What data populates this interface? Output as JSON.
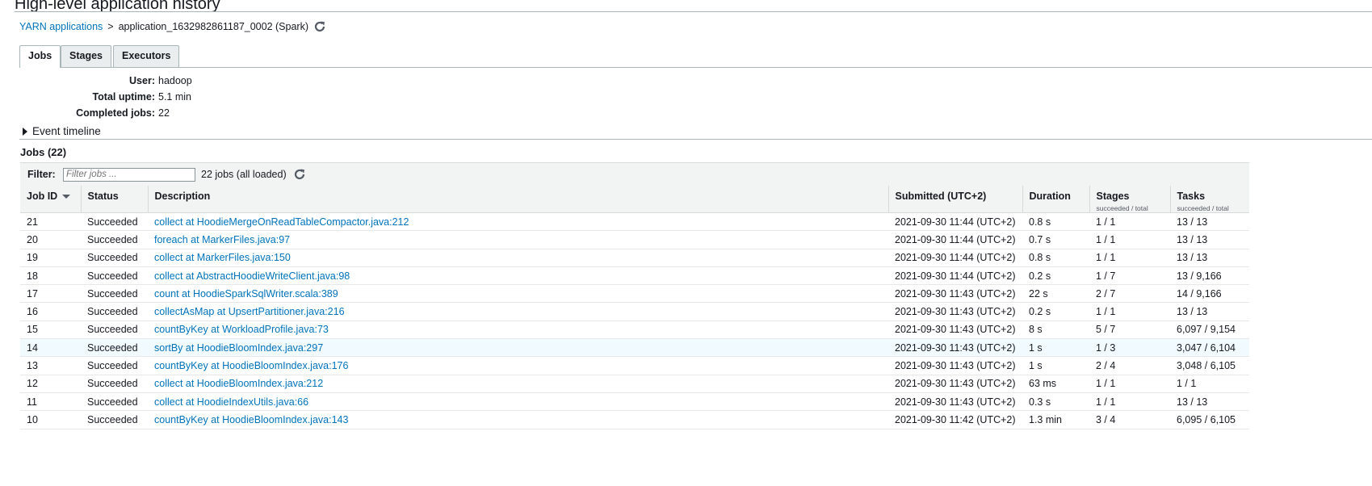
{
  "page": {
    "title": "High-level application history"
  },
  "breadcrumb": {
    "root": "YARN applications",
    "separator": ">",
    "current": "application_1632982861187_0002 (Spark)",
    "refresh_icon": "refresh-icon"
  },
  "tabs": [
    {
      "label": "Jobs",
      "active": true
    },
    {
      "label": "Stages",
      "active": false
    },
    {
      "label": "Executors",
      "active": false
    }
  ],
  "summary": {
    "user_label": "User:",
    "user_value": "hadoop",
    "uptime_label": "Total uptime:",
    "uptime_value": "5.1 min",
    "completed_label": "Completed jobs:",
    "completed_value": "22"
  },
  "timeline": {
    "label": "Event timeline",
    "icon": "caret-right-icon"
  },
  "jobs": {
    "heading": "Jobs (22)",
    "filter_label": "Filter:",
    "filter_placeholder": "Filter jobs ...",
    "filter_value": "",
    "loaded_text": "22 jobs (all loaded)",
    "columns": {
      "job_id": "Job ID",
      "status": "Status",
      "description": "Description",
      "submitted": "Submitted (UTC+2)",
      "duration": "Duration",
      "stages": "Stages",
      "stages_sub": "succeeded / total",
      "tasks": "Tasks",
      "tasks_sub": "succeeded / total"
    },
    "rows": [
      {
        "id": "21",
        "status": "Succeeded",
        "description": "collect at HoodieMergeOnReadTableCompactor.java:212",
        "submitted": "2021-09-30 11:44 (UTC+2)",
        "duration": "0.8 s",
        "stages": "1 / 1",
        "tasks": "13 / 13"
      },
      {
        "id": "20",
        "status": "Succeeded",
        "description": "foreach at MarkerFiles.java:97",
        "submitted": "2021-09-30 11:44 (UTC+2)",
        "duration": "0.7 s",
        "stages": "1 / 1",
        "tasks": "13 / 13"
      },
      {
        "id": "19",
        "status": "Succeeded",
        "description": "collect at MarkerFiles.java:150",
        "submitted": "2021-09-30 11:44 (UTC+2)",
        "duration": "0.8 s",
        "stages": "1 / 1",
        "tasks": "13 / 13"
      },
      {
        "id": "18",
        "status": "Succeeded",
        "description": "collect at AbstractHoodieWriteClient.java:98",
        "submitted": "2021-09-30 11:44 (UTC+2)",
        "duration": "0.2 s",
        "stages": "1 / 7",
        "tasks": "13 / 9,166"
      },
      {
        "id": "17",
        "status": "Succeeded",
        "description": "count at HoodieSparkSqlWriter.scala:389",
        "submitted": "2021-09-30 11:43 (UTC+2)",
        "duration": "22 s",
        "stages": "2 / 7",
        "tasks": "14 / 9,166"
      },
      {
        "id": "16",
        "status": "Succeeded",
        "description": "collectAsMap at UpsertPartitioner.java:216",
        "submitted": "2021-09-30 11:43 (UTC+2)",
        "duration": "0.2 s",
        "stages": "1 / 1",
        "tasks": "13 / 13"
      },
      {
        "id": "15",
        "status": "Succeeded",
        "description": "countByKey at WorkloadProfile.java:73",
        "submitted": "2021-09-30 11:43 (UTC+2)",
        "duration": "8 s",
        "stages": "5 / 7",
        "tasks": "6,097 / 9,154"
      },
      {
        "id": "14",
        "status": "Succeeded",
        "description": "sortBy at HoodieBloomIndex.java:297",
        "submitted": "2021-09-30 11:43 (UTC+2)",
        "duration": "1 s",
        "stages": "1 / 3",
        "tasks": "3,047 / 6,104",
        "highlighted": true
      },
      {
        "id": "13",
        "status": "Succeeded",
        "description": "countByKey at HoodieBloomIndex.java:176",
        "submitted": "2021-09-30 11:43 (UTC+2)",
        "duration": "1 s",
        "stages": "2 / 4",
        "tasks": "3,048 / 6,105"
      },
      {
        "id": "12",
        "status": "Succeeded",
        "description": "collect at HoodieBloomIndex.java:212",
        "submitted": "2021-09-30 11:43 (UTC+2)",
        "duration": "63 ms",
        "stages": "1 / 1",
        "tasks": "1 / 1"
      },
      {
        "id": "11",
        "status": "Succeeded",
        "description": "collect at HoodieIndexUtils.java:66",
        "submitted": "2021-09-30 11:43 (UTC+2)",
        "duration": "0.3 s",
        "stages": "1 / 1",
        "tasks": "13 / 13"
      },
      {
        "id": "10",
        "status": "Succeeded",
        "description": "countByKey at HoodieBloomIndex.java:143",
        "submitted": "2021-09-30 11:42 (UTC+2)",
        "duration": "1.3 min",
        "stages": "3 / 4",
        "tasks": "6,095 / 6,105"
      }
    ]
  },
  "colors": {
    "link": "#0073bb",
    "header_bg": "#f2f3f3",
    "highlight_row": "#f1faff",
    "border": "#aab7b8"
  }
}
